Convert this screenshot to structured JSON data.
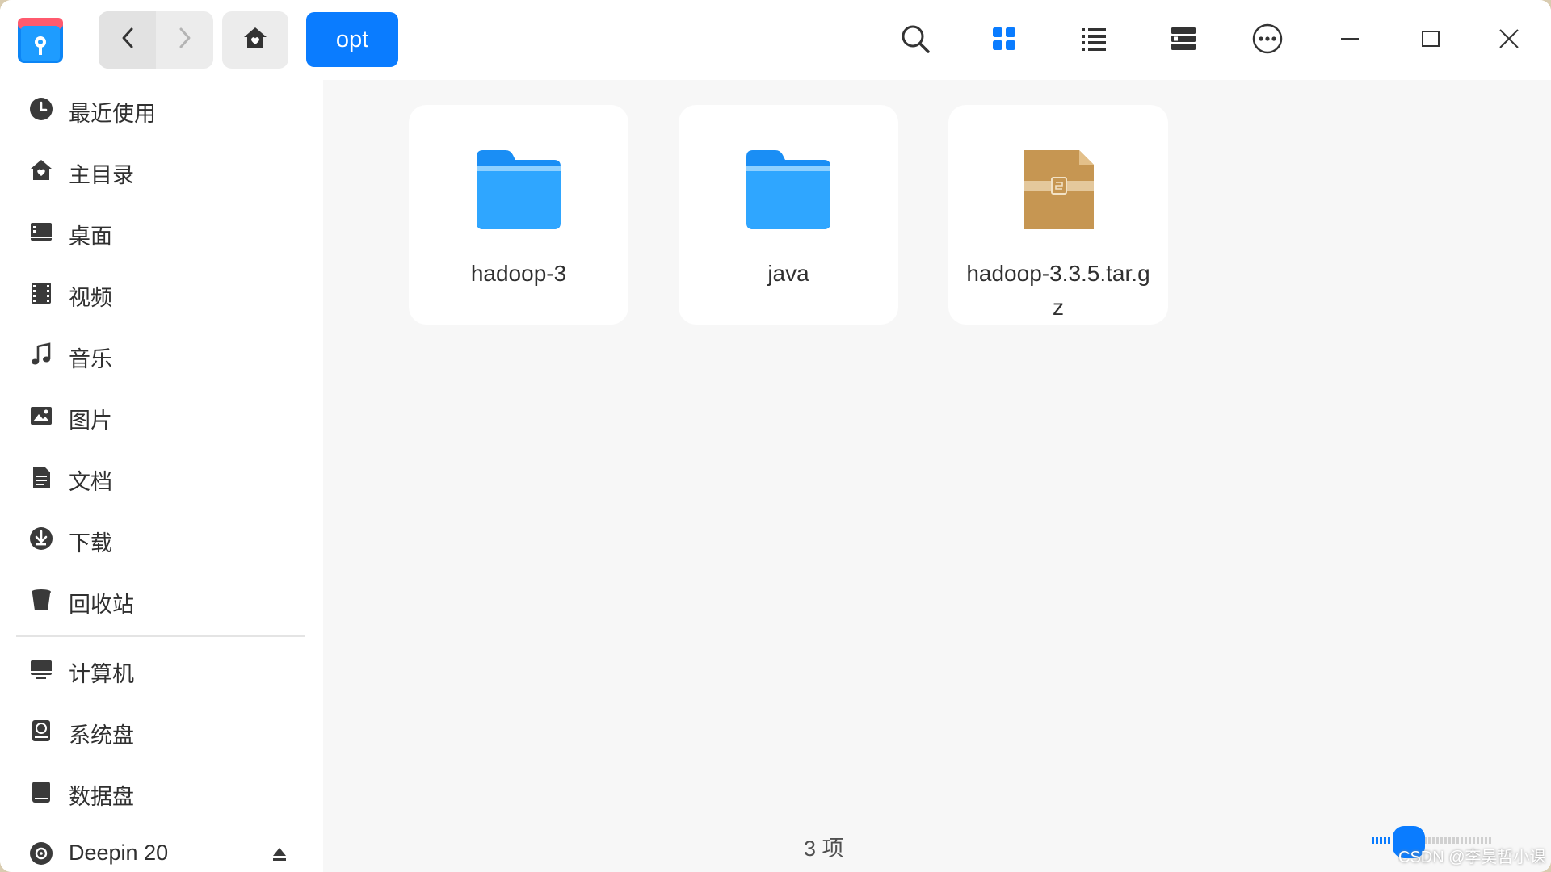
{
  "titlebar": {
    "app_icon": "file-manager-icon",
    "back_icon": "chevron-left-icon",
    "forward_icon": "chevron-right-icon",
    "home_icon": "home-icon",
    "breadcrumb": "opt",
    "toolbar_icons": [
      "search-icon",
      "grid-view-icon",
      "list-view-icon",
      "tree-view-icon",
      "more-icon",
      "minimize-icon",
      "maximize-icon",
      "close-icon"
    ]
  },
  "sidebar": {
    "items": [
      {
        "label": "最近使用",
        "icon": "recent-icon"
      },
      {
        "label": "主目录",
        "icon": "home-icon"
      },
      {
        "label": "桌面",
        "icon": "desktop-icon"
      },
      {
        "label": "视频",
        "icon": "video-icon"
      },
      {
        "label": "音乐",
        "icon": "music-icon"
      },
      {
        "label": "图片",
        "icon": "picture-icon"
      },
      {
        "label": "文档",
        "icon": "document-icon"
      },
      {
        "label": "下载",
        "icon": "download-icon"
      },
      {
        "label": "回收站",
        "icon": "trash-icon"
      }
    ],
    "devices": [
      {
        "label": "计算机",
        "icon": "computer-icon"
      },
      {
        "label": "系统盘",
        "icon": "system-disk-icon"
      },
      {
        "label": "数据盘",
        "icon": "data-disk-icon"
      },
      {
        "label": "Deepin 20",
        "icon": "optical-disc-icon"
      }
    ]
  },
  "files": [
    {
      "name": "hadoop-3",
      "type": "folder"
    },
    {
      "name": "java",
      "type": "folder"
    },
    {
      "name": "hadoop-3.3.5.tar.gz",
      "type": "archive"
    }
  ],
  "status": {
    "count": "3 项"
  },
  "watermark": "CSDN @李昊哲小课",
  "colors": {
    "accent": "#0a7cff",
    "folder": "#1f9bff",
    "archive": "#c69652"
  }
}
